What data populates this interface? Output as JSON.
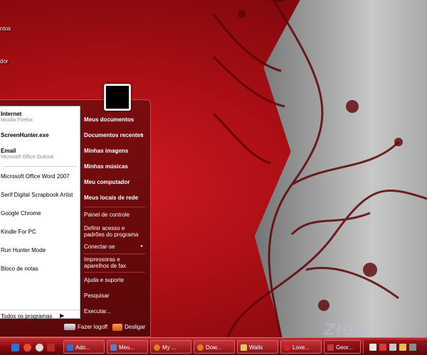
{
  "desktop": {
    "icon_labels": [
      "ntos",
      "dor"
    ]
  },
  "start_menu": {
    "pinned": [
      {
        "title": "Internet",
        "subtitle": "Mozilla Firefox",
        "icon": "firefox-icon"
      },
      {
        "title": "ScreenHunter.exe",
        "subtitle": "",
        "icon": "screenhunter-icon"
      },
      {
        "title": "Email",
        "subtitle": "Microsoft Office Outlook",
        "icon": "outlook-icon"
      }
    ],
    "recent": [
      "Microsoft Office Word 2007",
      "Serif Digital Scrapbook Artist",
      "Google Chrome",
      "Kindle For PC",
      "Run Hunter Mode",
      "Bloco de notas"
    ],
    "all_programs": "Todos os programas",
    "all_programs_arrow": "▶",
    "right_items": [
      {
        "label": "Meus documentos",
        "bold": true
      },
      {
        "label": "Documentos recentes",
        "bold": true,
        "arrow": "▸"
      },
      {
        "label": "Minhas imagens",
        "bold": true
      },
      {
        "label": "Minhas músicas",
        "bold": true
      },
      {
        "label": "Meu computador",
        "bold": true
      },
      {
        "label": "Meus locais de rede",
        "bold": true
      },
      {
        "label": "Painel de controle",
        "bold": false
      },
      {
        "label": "Definir acesso e padrões do programa",
        "bold": false
      },
      {
        "label": "Conectar-se",
        "bold": false,
        "arrow": "▸"
      },
      {
        "label": "Impressoras e aparelhos de fax",
        "bold": false
      },
      {
        "label": "Ajuda e suporte",
        "bold": false
      },
      {
        "label": "Pesquisar",
        "bold": false
      },
      {
        "label": "Executar...",
        "bold": false
      }
    ],
    "logoff_label": "Fazer logoff",
    "shutdown_label": "Desligar"
  },
  "taskbar": {
    "buttons": [
      {
        "label": "Ado...",
        "icon_color": "#2b6ed4"
      },
      {
        "label": "Meu...",
        "icon_color": "#4d86c7"
      },
      {
        "label": "My ...",
        "icon_color": "#e07b1e"
      },
      {
        "label": "Dow...",
        "icon_color": "#e07b1e"
      },
      {
        "label": "Walls",
        "icon_color": "#e8c85a"
      },
      {
        "label": "Love...",
        "icon_color": "#d8222a"
      },
      {
        "label": "Geor...",
        "icon_color": "#c23a3a"
      }
    ]
  },
  "watermark": "ZIGG",
  "colors": {
    "menu_bg": "#6a0a0d",
    "taskbar": "#8c0c10",
    "accent_red": "#d31a22"
  }
}
